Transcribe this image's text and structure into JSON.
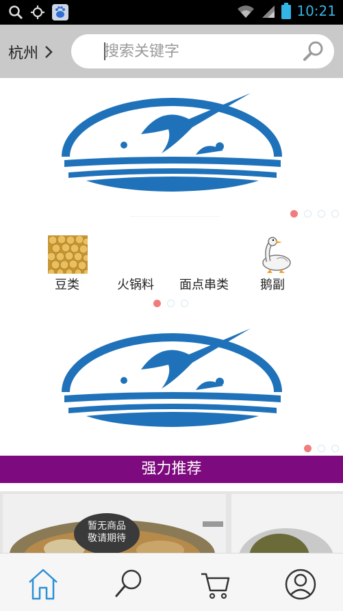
{
  "status_bar": {
    "time": "10:21",
    "icons": [
      "search-icon",
      "gps-icon",
      "baidu-app-icon",
      "wifi-icon",
      "signal-icon",
      "battery-icon"
    ]
  },
  "header": {
    "city": "杭州",
    "search_placeholder": "搜索关键字"
  },
  "banners": [
    {
      "image": "fish-logo",
      "slides": 4,
      "active_index": 0
    },
    {
      "image": "fish-logo",
      "slides": 3,
      "active_index": 0
    }
  ],
  "categories": {
    "items": [
      {
        "label": "豆类",
        "icon": "soybeans-image"
      },
      {
        "label": "火锅料",
        "icon": ""
      },
      {
        "label": "面点串类",
        "icon": ""
      },
      {
        "label": "鹅副",
        "icon": "goose-image"
      }
    ],
    "pages": 3,
    "active_index": 0
  },
  "section": {
    "title": "强力推荐"
  },
  "products": [
    {
      "placeholder_line1": "暂无商品",
      "placeholder_line2": "敬请期待"
    },
    {
      "placeholder_line1": "",
      "placeholder_line2": ""
    }
  ],
  "bottom_nav": {
    "items": [
      "home-icon",
      "search-icon",
      "cart-icon",
      "user-icon"
    ],
    "active": "home-icon"
  },
  "colors": {
    "accent_purple": "#7d0a7e",
    "active_tab_blue": "#2b8fd6",
    "dot_active": "#f07d7d"
  }
}
